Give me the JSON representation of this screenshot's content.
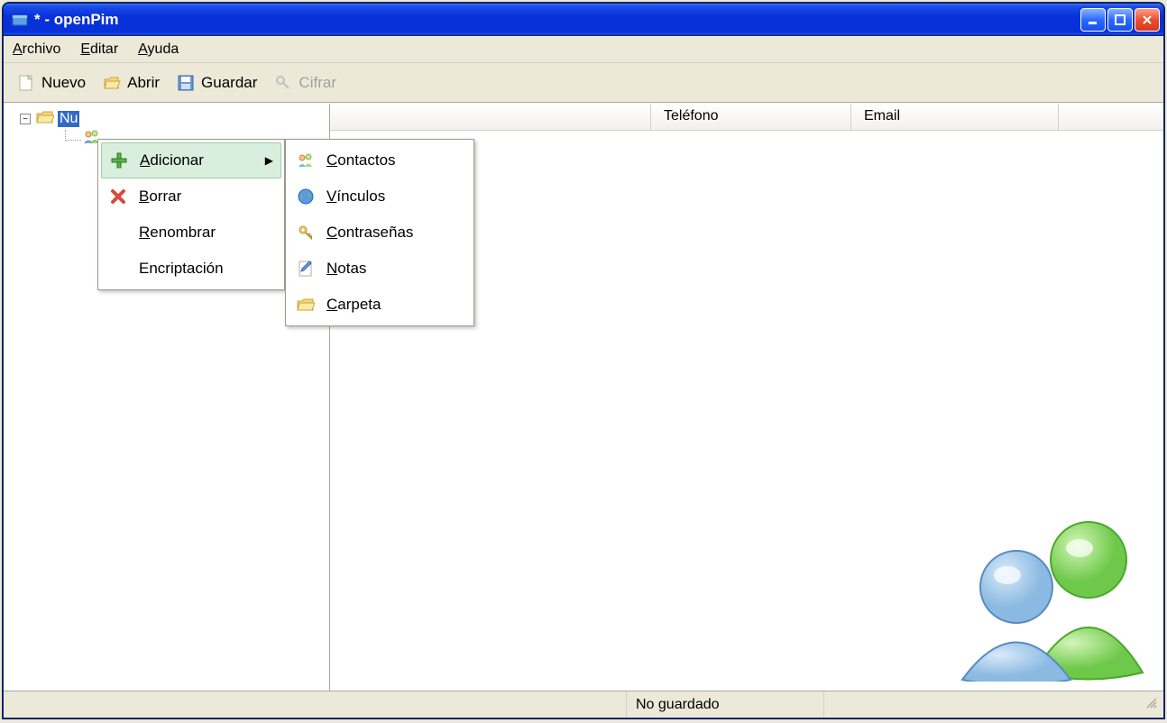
{
  "window": {
    "title": "* - openPim"
  },
  "menubar": {
    "archivo": "Archivo",
    "editar": "Editar",
    "ayuda": "Ayuda"
  },
  "toolbar": {
    "nuevo": "Nuevo",
    "abrir": "Abrir",
    "guardar": "Guardar",
    "cifrar": "Cifrar"
  },
  "tree": {
    "root_label_visible": "Nu"
  },
  "columns": {
    "telefono": "Teléfono",
    "email": "Email"
  },
  "context_menu_1": {
    "adicionar": "Adicionar",
    "borrar": "Borrar",
    "renombrar": "Renombrar",
    "encriptacion": "Encriptación"
  },
  "context_menu_2": {
    "contactos": "Contactos",
    "vinculos": "Vínculos",
    "contrasenas": "Contraseñas",
    "notas": "Notas",
    "carpeta": "Carpeta"
  },
  "statusbar": {
    "text": "No guardado"
  }
}
